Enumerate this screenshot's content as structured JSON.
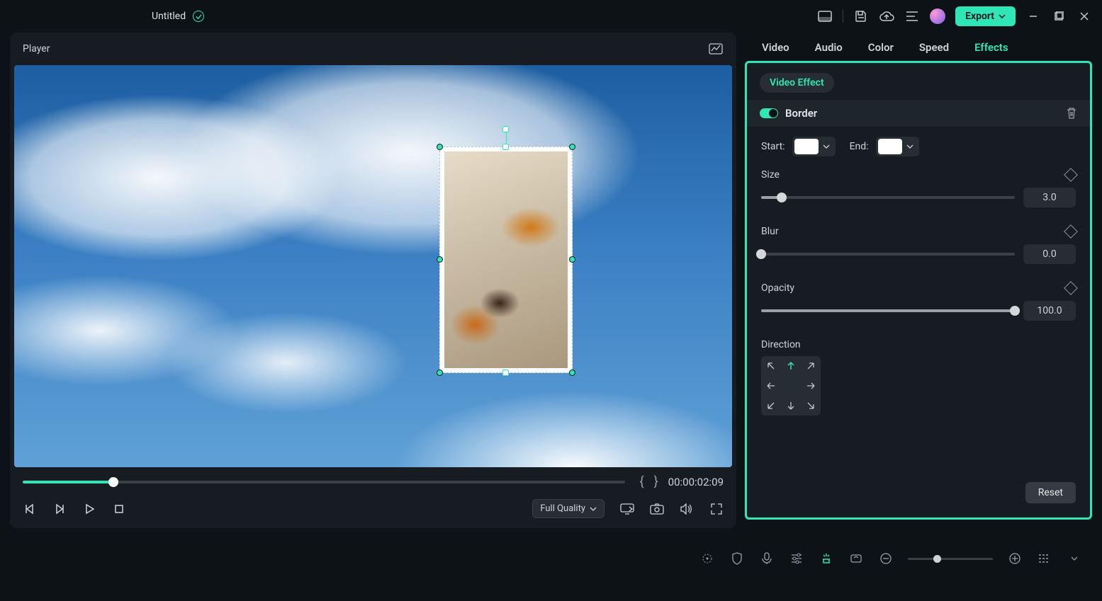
{
  "title": "Untitled",
  "export_label": "Export",
  "player": {
    "label": "Player",
    "timecode": "00:00:02:09",
    "quality": "Full Quality"
  },
  "inspector": {
    "tabs": [
      "Video",
      "Audio",
      "Color",
      "Speed",
      "Effects"
    ],
    "active_tab": "Effects",
    "chip": "Video Effect",
    "section": "Border",
    "start_label": "Start:",
    "end_label": "End:",
    "props": {
      "size": {
        "label": "Size",
        "value": "3.0",
        "percent": 8
      },
      "blur": {
        "label": "Blur",
        "value": "0.0",
        "percent": 0
      },
      "opacity": {
        "label": "Opacity",
        "value": "100.0",
        "percent": 100
      }
    },
    "direction_label": "Direction",
    "reset": "Reset"
  }
}
